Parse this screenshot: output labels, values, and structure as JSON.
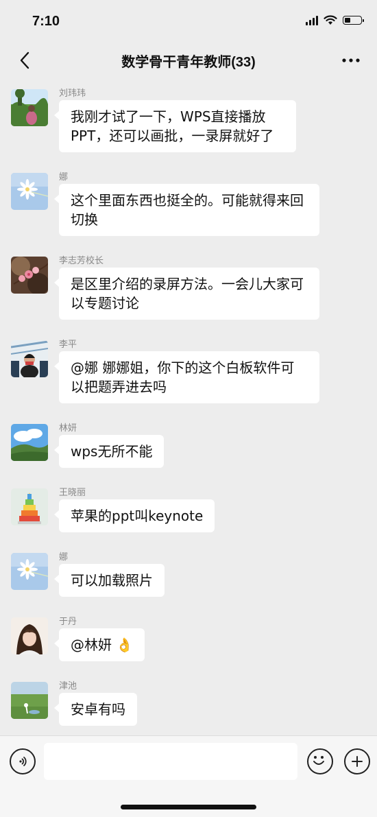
{
  "status": {
    "time": "7:10",
    "battery_level": 0.35
  },
  "nav": {
    "title": "数学骨干青年教师(33)",
    "back_icon": "chevron-left-icon",
    "more_icon": "more-dots-icon"
  },
  "messages": [
    {
      "sender": "刘玮玮",
      "text": "我刚才试了一下，WPS直接播放PPT，还可以画批，一录屏就好了",
      "avatar": "meadow-photo"
    },
    {
      "sender": "娜",
      "text": "这个里面东西也挺全的。可能就得来回切换",
      "avatar": "daisy-photo"
    },
    {
      "sender": "李志芳校长",
      "text": "是区里介绍的录屏方法。一会儿大家可以专题讨论",
      "avatar": "blossom-photo"
    },
    {
      "sender": "李平",
      "text": "@娜 娜娜姐，你下的这个白板软件可以把题弄进去吗",
      "avatar": "person-photo"
    },
    {
      "sender": "林妍",
      "text": "wps无所不能",
      "avatar": "landscape-photo"
    },
    {
      "sender": "王晓丽",
      "text": "苹果的ppt叫keynote",
      "avatar": "rainbow-cake-photo"
    },
    {
      "sender": "娜",
      "text": "可以加载照片",
      "avatar": "daisy-photo"
    },
    {
      "sender": "于丹",
      "text": "@林妍 👌",
      "avatar": "portrait-photo"
    },
    {
      "sender": "津池",
      "text": "安卓有吗",
      "avatar": "grassland-photo"
    }
  ],
  "input": {
    "placeholder": "",
    "voice_icon": "voice-icon",
    "emoji_icon": "emoji-icon",
    "plus_icon": "plus-icon"
  }
}
